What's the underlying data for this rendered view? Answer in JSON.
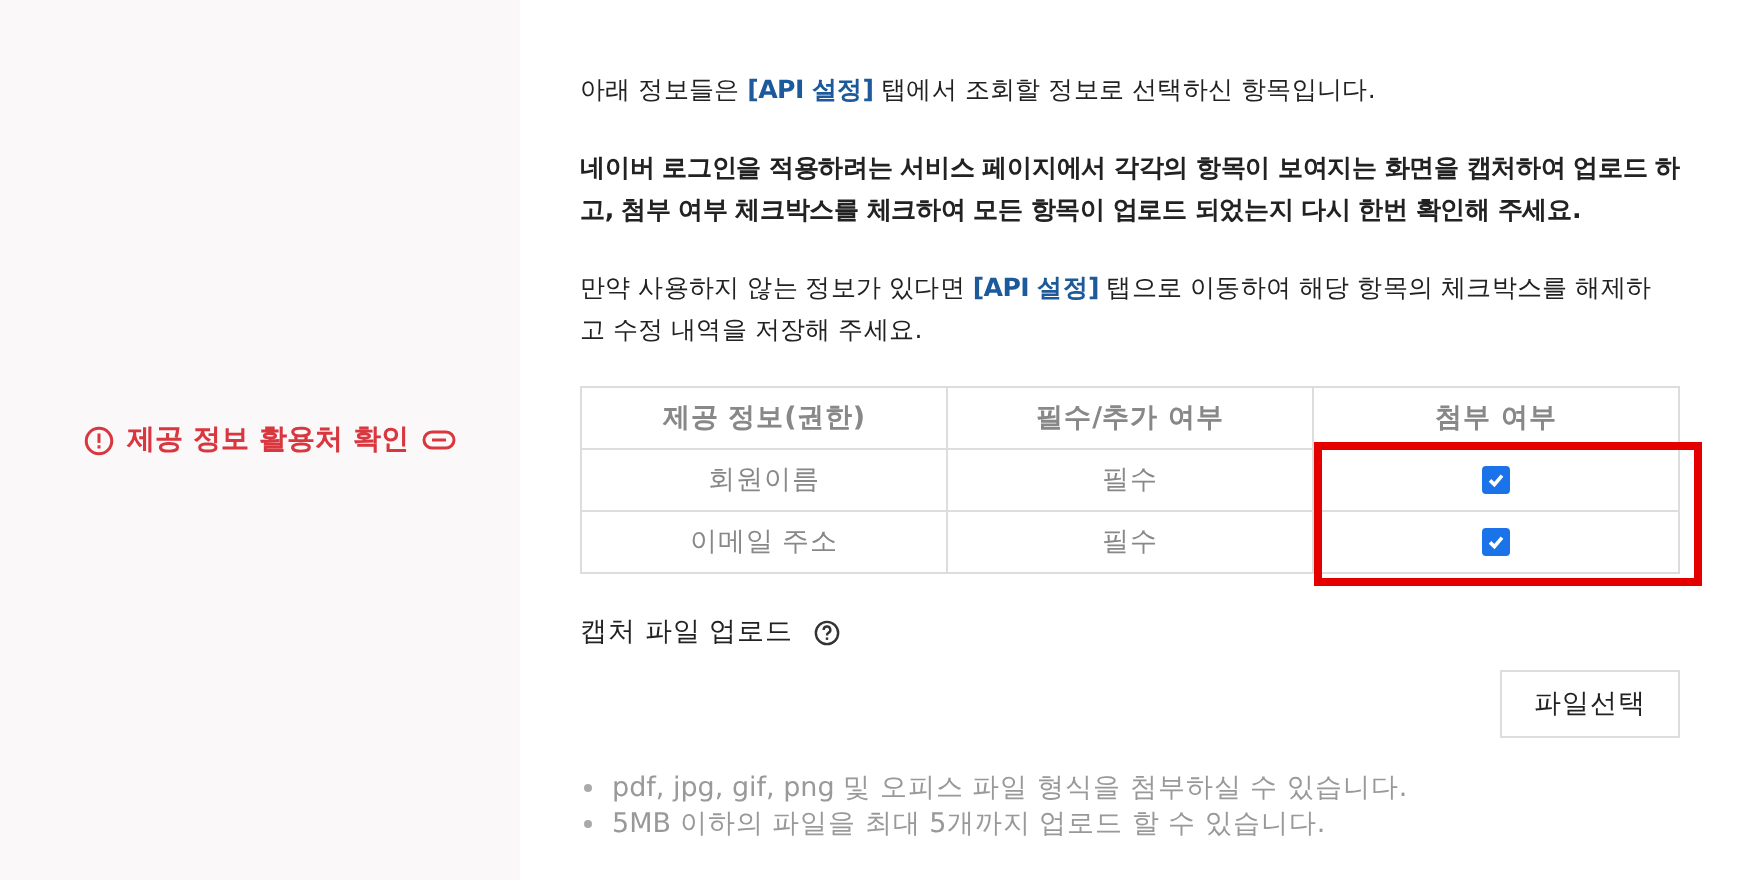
{
  "sidebar": {
    "label": "제공 정보 활용처 확인"
  },
  "paragraphs": [
    {
      "kind": "plain",
      "parts": [
        {
          "text": "아래 정보들은 ",
          "kind": "text"
        },
        {
          "text": "[API 설정]",
          "kind": "link"
        },
        {
          "text": " 탭에서 조회할 정보로 선택하신 항목입니다.",
          "kind": "text"
        }
      ]
    },
    {
      "kind": "emphasis",
      "parts": [
        {
          "text": "네이버 로그인을 적용하려는 서비스 페이지에서 각각의 항목이 보여지는 화면을 캡처하여 업로드 하고, 첨부 여부 체크박스를 체크하여 모든 항목이 업로드 되었는지 다시 한번 확인해 주세요.",
          "kind": "text"
        }
      ]
    },
    {
      "kind": "plain",
      "parts": [
        {
          "text": "만약 사용하지 않는 정보가 있다면 ",
          "kind": "text"
        },
        {
          "text": "[API 설정]",
          "kind": "link"
        },
        {
          "text": " 탭으로 이동하여 해당 항목의 체크박스를 해제하고 수정 내역을 저장해 주세요.",
          "kind": "text"
        }
      ]
    }
  ],
  "table": {
    "columns": [
      {
        "label": "제공 정보(권한)",
        "highlighted": false
      },
      {
        "label": "필수/추가 여부",
        "highlighted": false
      },
      {
        "label": "첨부 여부",
        "highlighted": true
      }
    ],
    "rows": [
      {
        "name": "회원이름",
        "requirement": "필수",
        "checked": true
      },
      {
        "name": "이메일 주소",
        "requirement": "필수",
        "checked": true
      }
    ]
  },
  "upload": {
    "label": "캡처 파일 업로드",
    "button": "파일선택",
    "notes": [
      "pdf, jpg, gif, png 및 오피스 파일 형식을 첨부하실 수 있습니다.",
      "5MB 이하의 파일을 최대 5개까지 업로드 할 수 있습니다."
    ]
  }
}
